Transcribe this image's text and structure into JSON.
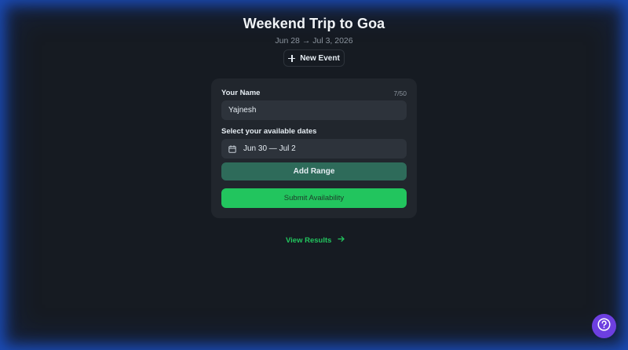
{
  "event": {
    "title": "Weekend Trip to Goa",
    "date_range": "Jun 28 → Jul 3, 2026"
  },
  "toolbar": {
    "new_event_label": "New Event",
    "new_event_icon": "plus-icon"
  },
  "form": {
    "name_label": "Your Name",
    "name_counter": "7/50",
    "name_value": "Yajnesh",
    "dates_label": "Select your available dates",
    "dates_value": "Jun 30 — Jul 2",
    "dates_icon": "calendar-icon",
    "add_range_label": "Add Range",
    "submit_label": "Submit Availability"
  },
  "footer": {
    "view_results_label": "View Results",
    "view_results_icon": "arrow-right-icon"
  },
  "help": {
    "icon": "help-icon"
  },
  "colors": {
    "background": "#161b22",
    "card": "#21262d",
    "accent_green": "#22c55e",
    "add_range_bg": "#2e6b5a",
    "help_purple": "#6d3fe0",
    "frame_glow": "#1e5adc"
  }
}
